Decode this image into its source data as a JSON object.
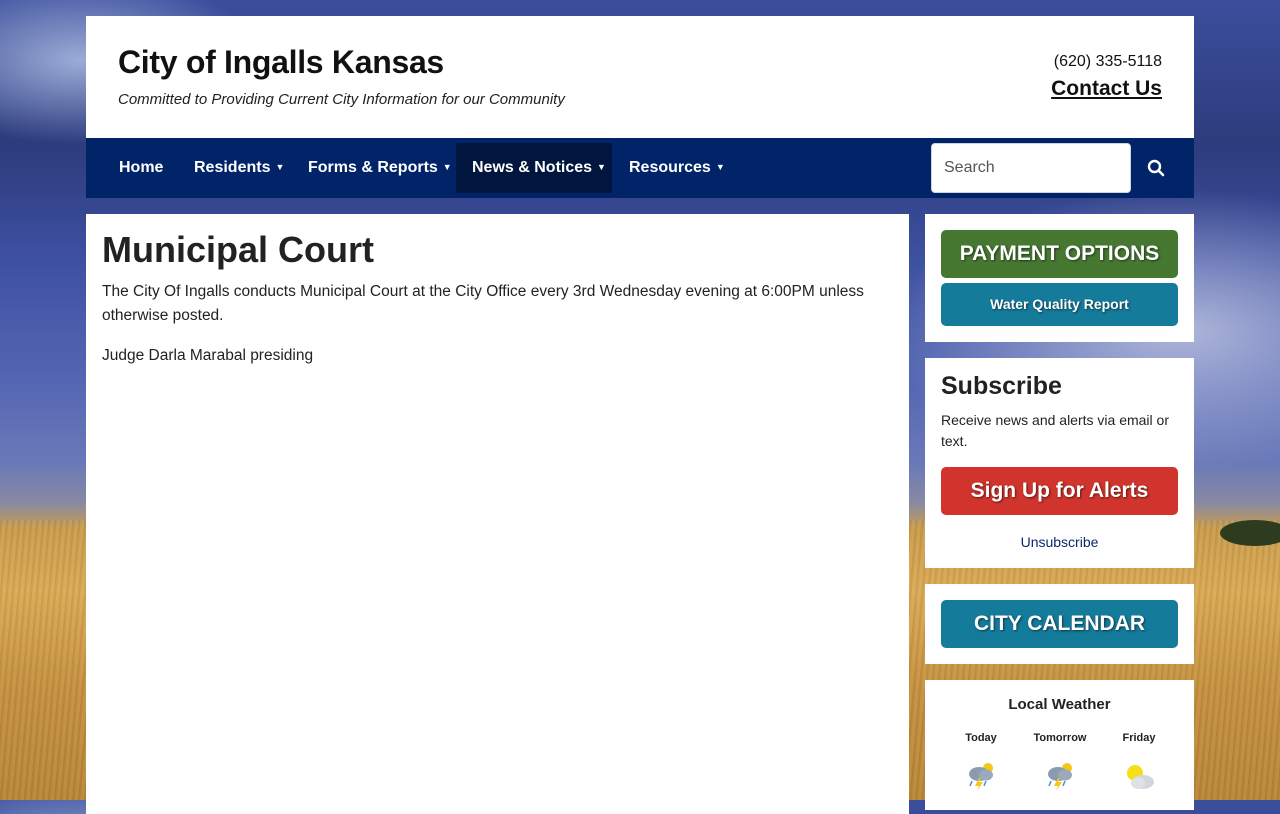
{
  "site": {
    "title": "City of Ingalls Kansas",
    "tagline": "Committed to Providing Current City Information for our Community",
    "phone": "(620) 335-5118",
    "contact_label": "Contact Us"
  },
  "nav": {
    "items": [
      {
        "label": "Home",
        "has_dropdown": false,
        "active": false
      },
      {
        "label": "Residents",
        "has_dropdown": true,
        "active": false
      },
      {
        "label": "Forms & Reports",
        "has_dropdown": true,
        "active": false
      },
      {
        "label": "News & Notices",
        "has_dropdown": true,
        "active": true
      },
      {
        "label": "Resources",
        "has_dropdown": true,
        "active": false
      }
    ],
    "search_placeholder": "Search",
    "search_icon": "search-icon"
  },
  "main": {
    "title": "Municipal Court",
    "paragraphs": [
      "The City Of Ingalls conducts Municipal Court at the City Office every 3rd Wednesday evening at 6:00PM unless otherwise posted.",
      "Judge Darla Marabal presiding"
    ]
  },
  "sidebar": {
    "payment_label": "PAYMENT OPTIONS",
    "water_label": "Water Quality Report",
    "subscribe": {
      "title": "Subscribe",
      "text": "Receive news and alerts via email or text.",
      "signup_label": "Sign Up for Alerts",
      "unsubscribe_label": "Unsubscribe"
    },
    "calendar_label": "CITY CALENDAR",
    "weather": {
      "title": "Local Weather",
      "days": [
        {
          "label": "Today",
          "icon": "thunderstorm-sun-icon"
        },
        {
          "label": "Tomorrow",
          "icon": "thunderstorm-sun-icon"
        },
        {
          "label": "Friday",
          "icon": "partly-cloudy-icon"
        }
      ]
    }
  },
  "colors": {
    "nav_bg": "#012469",
    "nav_active": "#00163f",
    "payment_green": "#467832",
    "teal": "#157b9b",
    "alert_red": "#d0342c"
  }
}
